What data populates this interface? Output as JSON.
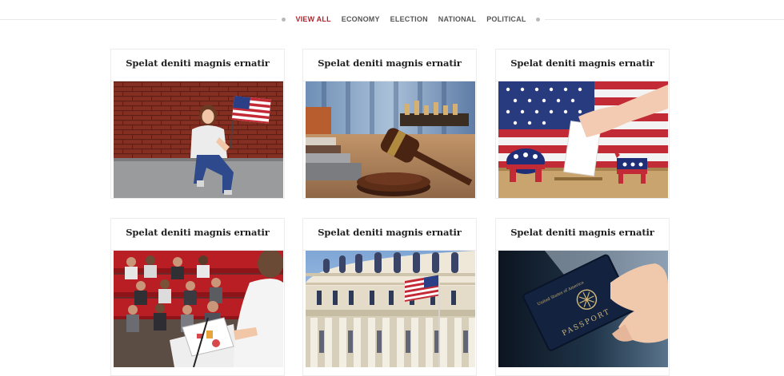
{
  "filter_menu": {
    "items": [
      {
        "label": "VIEW ALL",
        "active": true
      },
      {
        "label": "ECONOMY",
        "active": false
      },
      {
        "label": "ELECTION",
        "active": false
      },
      {
        "label": "NATIONAL",
        "active": false
      },
      {
        "label": "POLITICAL",
        "active": false
      }
    ],
    "active_color": "#b5202a"
  },
  "posts": [
    {
      "title": "Spelat deniti magnis ernatir",
      "image": "woman-with-american-flag-brick-wall"
    },
    {
      "title": "Spelat deniti magnis ernatir",
      "image": "judge-gavel-law-books"
    },
    {
      "title": "Spelat deniti magnis ernatir",
      "image": "ballot-box-elephant-donkey-flag"
    },
    {
      "title": "Spelat deniti magnis ernatir",
      "image": "speaker-at-podium-audience"
    },
    {
      "title": "Spelat deniti magnis ernatir",
      "image": "capitol-dome-with-flag"
    },
    {
      "title": "Spelat deniti magnis ernatir",
      "image": "hand-holding-us-passport"
    }
  ],
  "passport_text": "PASSPORT"
}
